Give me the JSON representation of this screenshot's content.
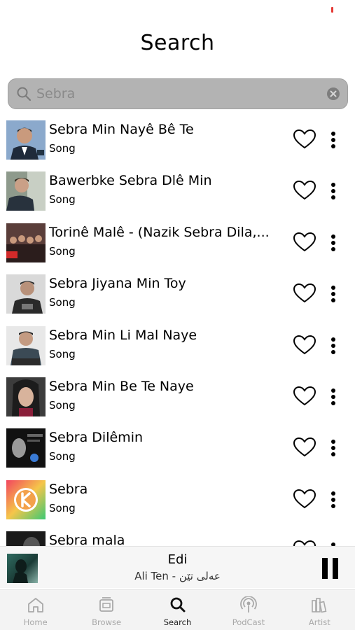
{
  "header": {
    "title": "Search"
  },
  "search": {
    "value": "Sebra"
  },
  "results": [
    {
      "title": "Sebra Min Nayê Bê Te",
      "subtitle": "Song",
      "thumb_icon": "cover-image-1"
    },
    {
      "title": "Bawerbke Sebra Dlê Min",
      "subtitle": "Song",
      "thumb_icon": "cover-image-2"
    },
    {
      "title": "Torinê Malê -  (Nazik Sebra Dila,...",
      "subtitle": "Song",
      "thumb_icon": "cover-image-3"
    },
    {
      "title": "Sebra Jiyana Min Toy",
      "subtitle": "Song",
      "thumb_icon": "cover-image-4"
    },
    {
      "title": "Sebra Min Li Mal Naye",
      "subtitle": "Song",
      "thumb_icon": "cover-image-5"
    },
    {
      "title": "Sebra Min Be Te Naye",
      "subtitle": "Song",
      "thumb_icon": "cover-image-6"
    },
    {
      "title": "Sebra Dilêmin",
      "subtitle": "Song",
      "thumb_icon": "cover-image-7"
    },
    {
      "title": "Sebra",
      "subtitle": "Song",
      "thumb_icon": "cover-image-8"
    },
    {
      "title": "Sebra mala",
      "subtitle": "",
      "thumb_icon": "cover-image-9"
    }
  ],
  "now_playing": {
    "title": "Edi",
    "artist": "Ali Ten - عەلی تێن"
  },
  "tabs": [
    {
      "label": "Home",
      "icon": "home-icon"
    },
    {
      "label": "Browse",
      "icon": "browse-icon"
    },
    {
      "label": "Search",
      "icon": "search-icon"
    },
    {
      "label": "PodCast",
      "icon": "podcast-icon"
    },
    {
      "label": "Artist",
      "icon": "artist-icon"
    }
  ],
  "colors": {
    "accent_dot": "#e53935",
    "search_bar": "#b3b3b3",
    "tab_inactive": "#a8a8a8"
  }
}
